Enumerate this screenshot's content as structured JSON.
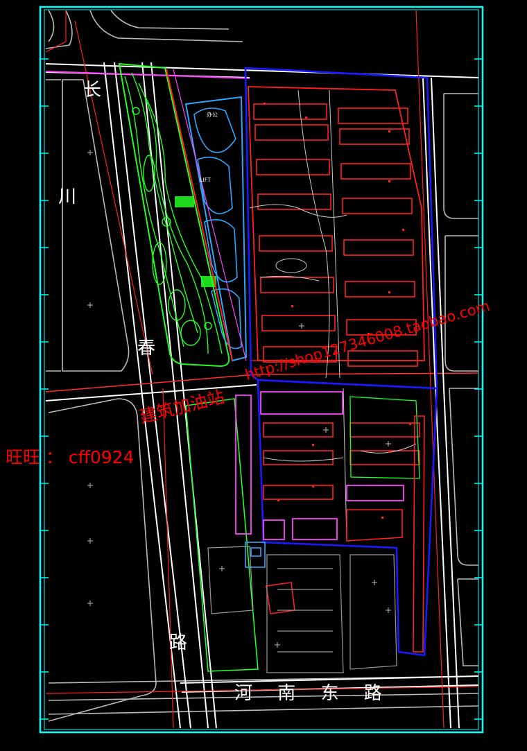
{
  "road_labels": {
    "west_1": "长",
    "west_2": "川",
    "west_3": "春",
    "west_4": "路",
    "south": "河 南 东 路"
  },
  "block_labels": {
    "office": "办公",
    "lift": "LIFT"
  },
  "watermarks": {
    "wangwang": "旺旺 ： cff0924",
    "studio": "建筑加油站",
    "url": "http://shop127346008.taobao.com"
  },
  "colors": {
    "background": "#000000",
    "frame": "#00ffff",
    "road": "#ffffff",
    "boundary": "#1a1aff",
    "building": "#ff2020",
    "park": "#22ff22",
    "water": "#2aa8ff",
    "amenity": "#ff40ff",
    "watermark": "#ff0000"
  }
}
